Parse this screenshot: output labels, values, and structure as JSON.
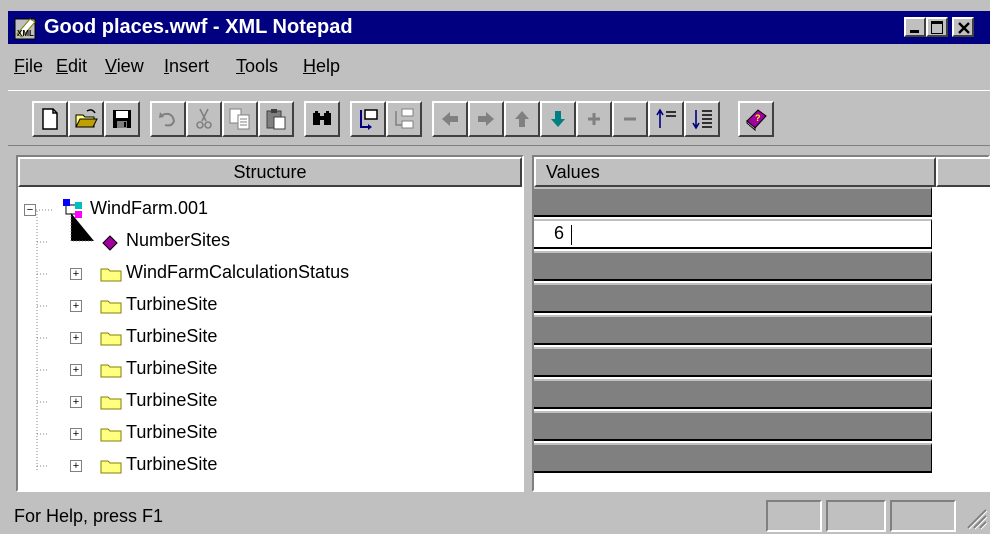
{
  "window": {
    "title": "Good places.wwf - XML Notepad"
  },
  "menu": [
    {
      "label": "File",
      "mnemonic": "F",
      "rest": "ile"
    },
    {
      "label": "Edit",
      "mnemonic": "E",
      "rest": "dit"
    },
    {
      "label": "View",
      "mnemonic": "V",
      "rest": "iew"
    },
    {
      "label": "Insert",
      "mnemonic": "I",
      "rest": "nsert"
    },
    {
      "label": "Tools",
      "mnemonic": "T",
      "rest": "ools"
    },
    {
      "label": "Help",
      "mnemonic": "H",
      "rest": "elp"
    }
  ],
  "toolbar_icons": [
    "new-icon",
    "open-icon",
    "save-icon",
    "undo-icon",
    "cut-icon",
    "copy-icon",
    "paste-icon",
    "find-icon",
    "insert-element-icon",
    "insert-attribute-icon",
    "move-left-icon",
    "move-right-icon",
    "move-up-icon",
    "move-down-icon",
    "expand-icon",
    "collapse-icon",
    "sort-asc-icon",
    "sort-desc-icon",
    "help-book-icon"
  ],
  "structure": {
    "header": "Structure",
    "root": "WindFarm.001",
    "items": [
      {
        "label": "NumberSites",
        "type": "element"
      },
      {
        "label": "WindFarmCalculationStatus",
        "type": "folder"
      },
      {
        "label": "TurbineSite",
        "type": "folder"
      },
      {
        "label": "TurbineSite",
        "type": "folder"
      },
      {
        "label": "TurbineSite",
        "type": "folder"
      },
      {
        "label": "TurbineSite",
        "type": "folder"
      },
      {
        "label": "TurbineSite",
        "type": "folder"
      },
      {
        "label": "TurbineSite",
        "type": "folder"
      }
    ]
  },
  "values": {
    "header": "Values",
    "number_sites_value": "6"
  },
  "status": {
    "text": "For Help, press F1"
  },
  "colors": {
    "titlebar": "#000080",
    "face": "#c0c0c0",
    "empty_value": "#808080",
    "element_icon": "#a000a0",
    "folder": "#ffff80"
  }
}
